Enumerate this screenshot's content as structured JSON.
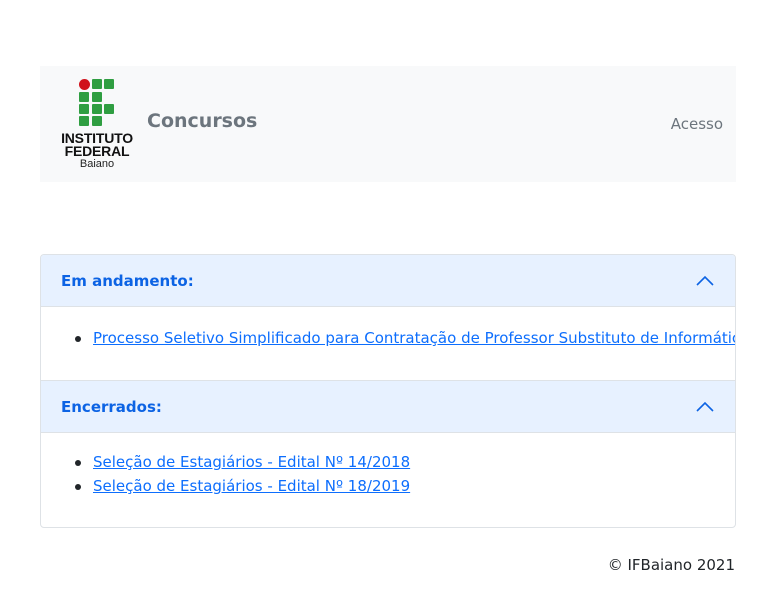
{
  "navbar": {
    "logo": {
      "line1": "INSTITUTO",
      "line2": "FEDERAL",
      "line3": "Baiano",
      "colors": {
        "dot": "#d0121b",
        "squares": "#2f9e41"
      }
    },
    "brand": "Concursos",
    "login_link": "Acesso"
  },
  "accordion": {
    "sections": [
      {
        "title": "Em andamento:",
        "expanded": true,
        "items": [
          "Processo Seletivo Simplificado para Contratação de Professor Substituto de Informática"
        ]
      },
      {
        "title": "Encerrados:",
        "expanded": true,
        "items": [
          "Seleção de Estagiários - Edital Nº 14/2018",
          "Seleção de Estagiários - Edital Nº 18/2019"
        ]
      }
    ],
    "icon": "chevron-up-icon"
  },
  "footer": {
    "copyright": "© IFBaiano 2021"
  }
}
